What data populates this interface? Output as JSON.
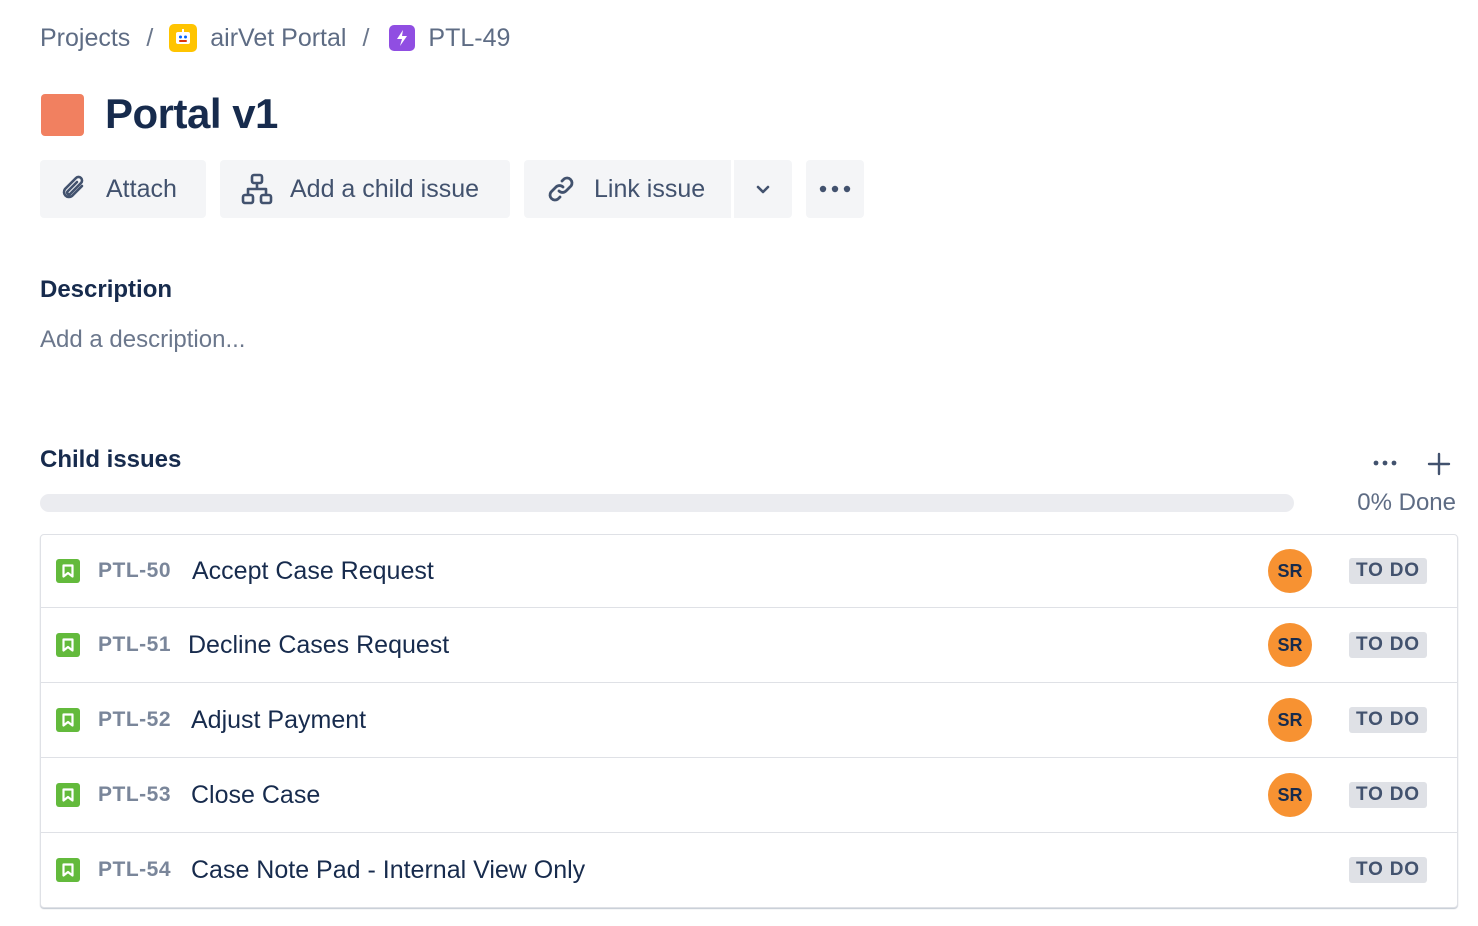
{
  "breadcrumb": {
    "projects": "Projects",
    "separator": "/",
    "project_name": "airVet Portal",
    "issue_key": "PTL-49"
  },
  "issue": {
    "title": "Portal v1",
    "color": "#f18060"
  },
  "toolbar": {
    "attach_label": "Attach",
    "add_child_label": "Add a child issue",
    "link_label": "Link issue"
  },
  "description": {
    "heading": "Description",
    "placeholder": "Add a description..."
  },
  "child_issues": {
    "heading": "Child issues",
    "progress_fraction": 0,
    "done_text": "0% Done",
    "items": [
      {
        "key": "PTL-50",
        "summary": "Accept Case Request",
        "assignee": "SR",
        "status": "TO DO"
      },
      {
        "key": "PTL-51",
        "summary": "Decline Cases Request",
        "assignee": "SR",
        "status": "TO DO"
      },
      {
        "key": "PTL-52",
        "summary": "Adjust Payment",
        "assignee": "SR",
        "status": "TO DO"
      },
      {
        "key": "PTL-53",
        "summary": "Close Case",
        "assignee": "SR",
        "status": "TO DO"
      },
      {
        "key": "PTL-54",
        "summary": "Case Note Pad - Internal View Only",
        "assignee": "",
        "status": "TO DO"
      }
    ]
  },
  "colors": {
    "story": "#63ba3c",
    "avatar": "#f79232",
    "project_icon": "#ffc400",
    "epic_key_icon": "#904ee2"
  },
  "icons": [
    "project-avatar-icon",
    "lightning-icon",
    "paperclip-icon",
    "hierarchy-icon",
    "link-icon",
    "chevron-down-icon",
    "more-icon",
    "plus-icon",
    "story-icon"
  ]
}
